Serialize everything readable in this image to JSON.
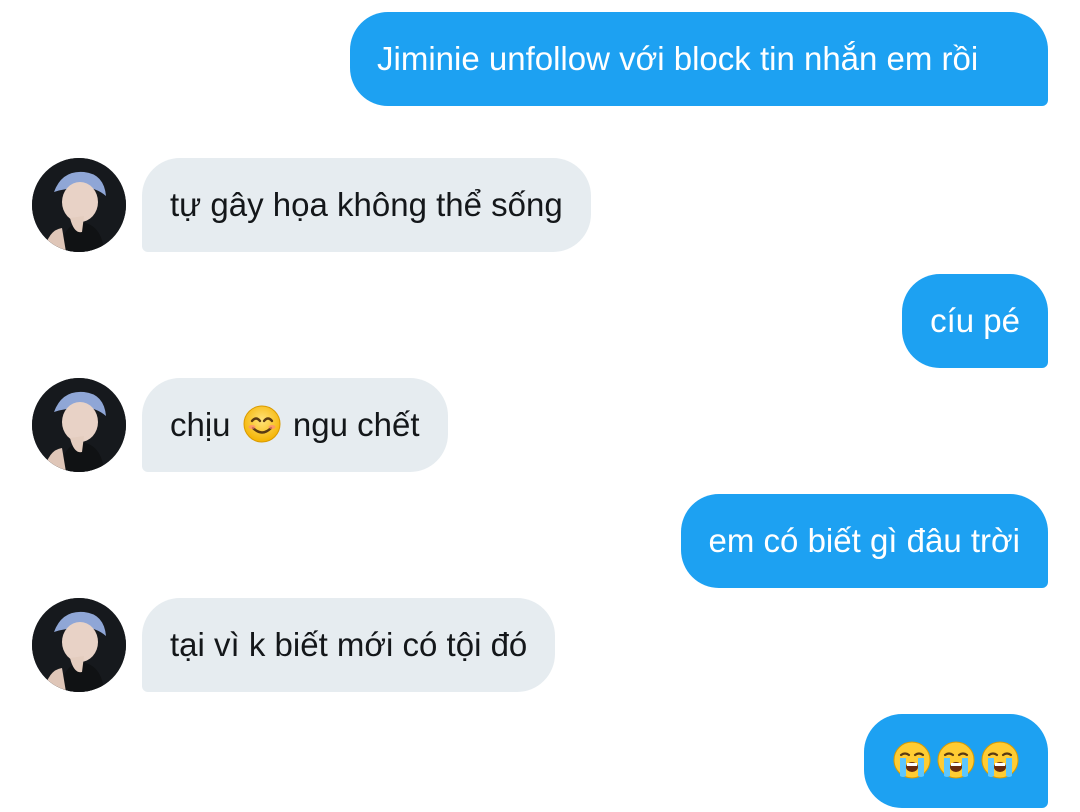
{
  "conversation": {
    "messages": [
      {
        "direction": "sent",
        "text": "Jiminie unfollow với block tin nhắn em rồi"
      },
      {
        "direction": "received",
        "text": "tự gây họa không thể sống"
      },
      {
        "direction": "sent",
        "text": "cíu pé"
      },
      {
        "direction": "received",
        "text_before": "chịu",
        "emoji": "smiling-face-with-smiling-eyes",
        "text_after": "ngu chết"
      },
      {
        "direction": "sent",
        "text": "em có biết gì đâu trời"
      },
      {
        "direction": "received",
        "text": "tại vì k biết mới có tội đó"
      },
      {
        "direction": "sent",
        "emojis": [
          "loudly-crying-face",
          "loudly-crying-face",
          "loudly-crying-face"
        ]
      }
    ]
  },
  "colors": {
    "sent_bubble": "#1da1f2",
    "received_bubble": "#e6ecf0",
    "sent_text": "#ffffff",
    "received_text": "#14171a"
  },
  "icons": {
    "contact_avatar": "avatar-photo-icon"
  }
}
